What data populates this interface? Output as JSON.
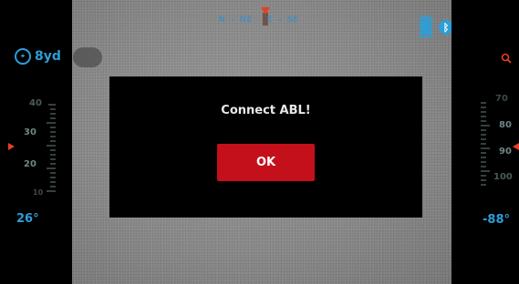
{
  "compass": {
    "labels": [
      "N",
      "NE",
      "E",
      "SE"
    ]
  },
  "status": {
    "battery_icon": "battery-icon",
    "bluetooth_icon": "bluetooth-icon",
    "wifi_icon": "wifi-icon",
    "accent_color": "#2c9ed8"
  },
  "left_panel": {
    "range_value": "8yd",
    "tilt_scale": [
      "40",
      "30",
      "20",
      "10"
    ],
    "angle": "26°"
  },
  "right_panel": {
    "search_icon": "search-icon",
    "elevation_scale": [
      "70",
      "80",
      "90",
      "100"
    ],
    "angle": "-88°"
  },
  "dialog": {
    "title": "Connect ABL!",
    "ok_label": "OK",
    "button_color": "#c4101a"
  }
}
